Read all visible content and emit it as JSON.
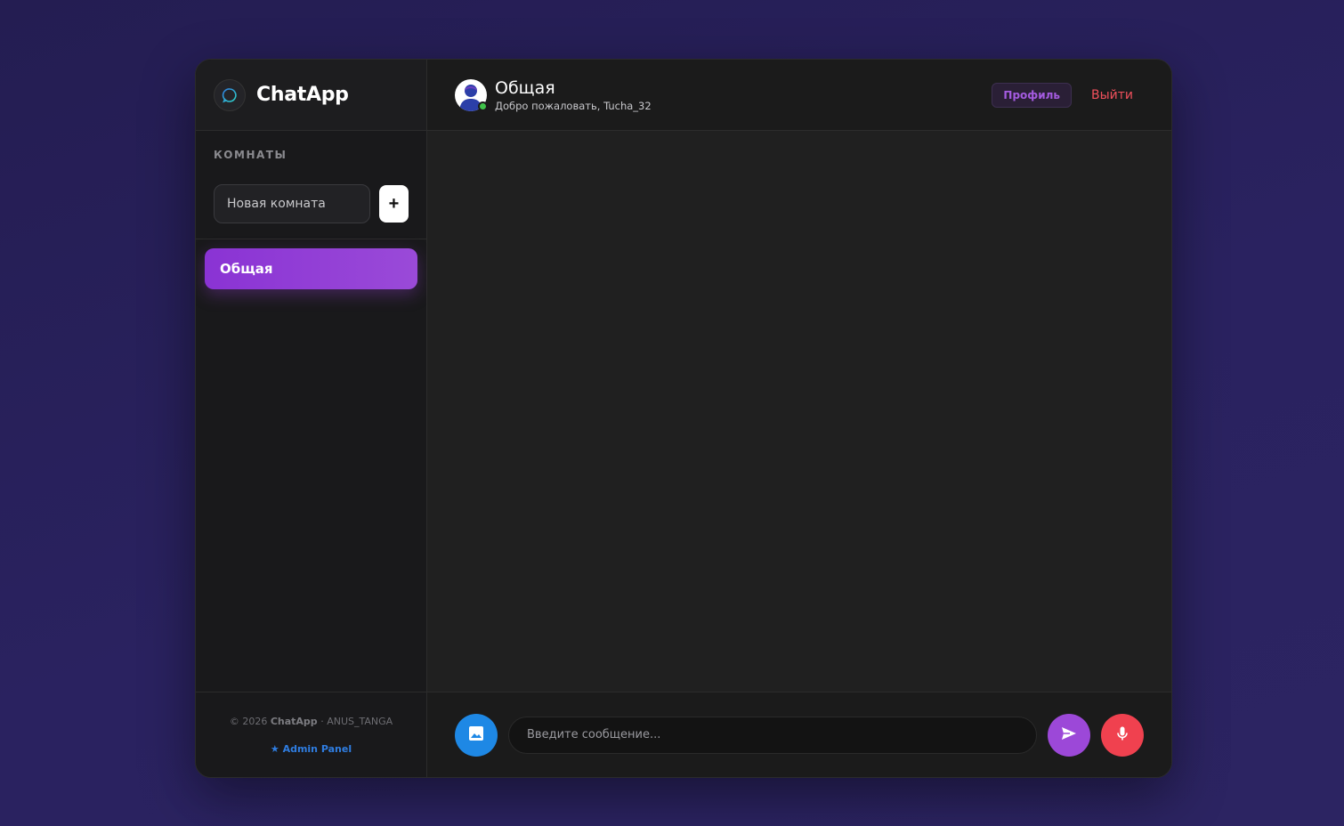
{
  "brand": {
    "name": "ChatApp",
    "logo_icon": "chat-bubble-icon"
  },
  "sidebar": {
    "rooms_title": "КОМНАТЫ",
    "new_room_placeholder": "Новая комната",
    "add_label": "+",
    "rooms": [
      {
        "label": "Общая",
        "active": true
      }
    ],
    "footer": {
      "copyright_prefix": "© 2026",
      "app_name": "ChatApp",
      "separator": "·",
      "username": "ANUS_TANGA",
      "admin_link": "★ Admin Panel"
    }
  },
  "header": {
    "title": "Общая",
    "subtitle": "Добро пожаловать, Tucha_32",
    "profile_label": "Профиль",
    "logout_label": "Выйти",
    "status": "online"
  },
  "composer": {
    "placeholder": "Введите сообщение...",
    "image_icon": "image-icon",
    "send_icon": "send-icon",
    "mic_icon": "microphone-icon"
  },
  "colors": {
    "accent_purple": "#9c48d8",
    "image_button": "#1e88e5",
    "mic_button": "#f0414f",
    "logout": "#f0505c",
    "online": "#3fc24a"
  }
}
